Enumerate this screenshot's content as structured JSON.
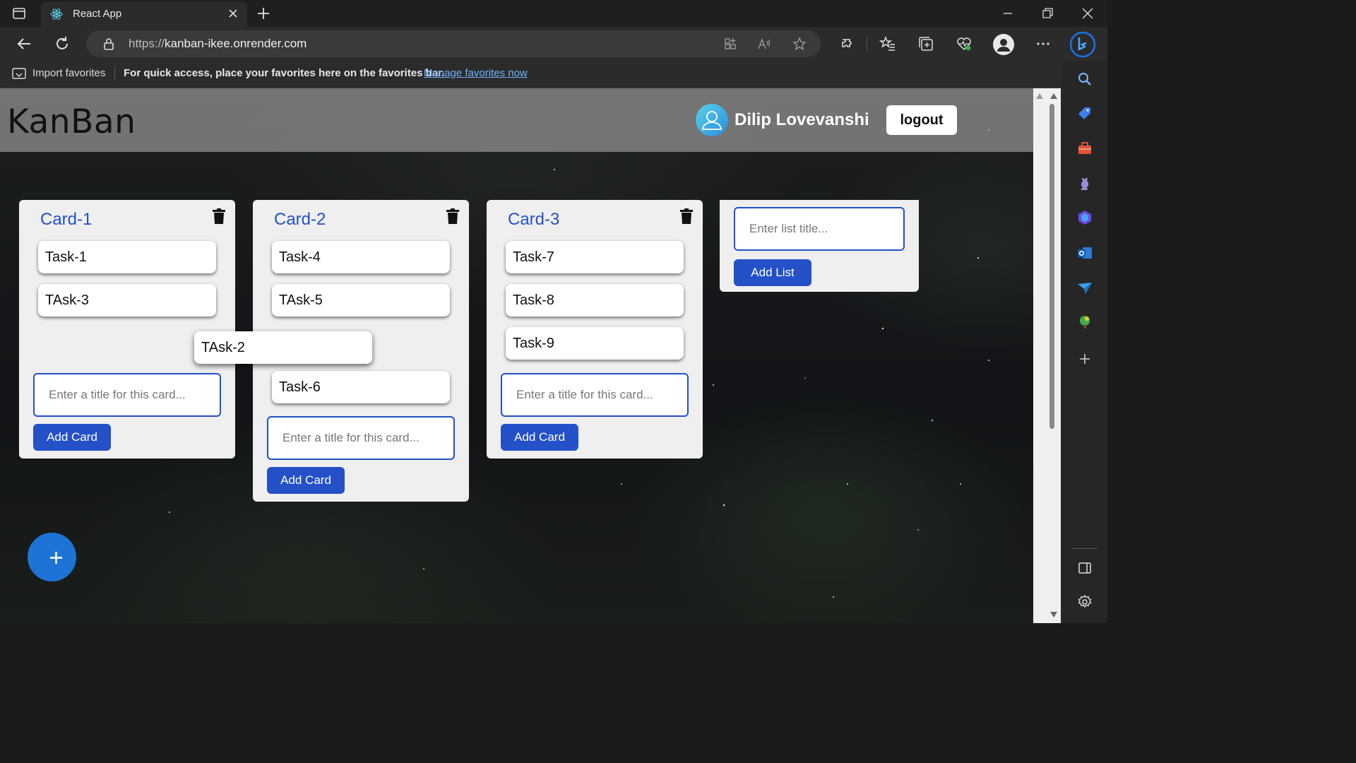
{
  "browser": {
    "tab_title": "React App",
    "url_prefix": "https://",
    "url_host": "kanban-ikee.onrender.com",
    "favorites": {
      "import_label": "Import favorites",
      "message": "For quick access, place your favorites here on the favorites bar.",
      "manage_link": "Manage favorites now"
    }
  },
  "app": {
    "brand": "KanBan",
    "user_name": "Dilip Lovevanshi",
    "logout_label": "logout",
    "card_input_placeholder": "Enter a title for this card...",
    "add_card_label": "Add Card",
    "list_title_placeholder": "Enter list title...",
    "add_list_label": "Add List",
    "dragging_task": "TAsk-2",
    "lists": [
      {
        "title": "Card-1",
        "tasks": [
          "Task-1",
          "TAsk-3"
        ]
      },
      {
        "title": "Card-2",
        "tasks": [
          "Task-4",
          "TAsk-5",
          "Task-6"
        ]
      },
      {
        "title": "Card-3",
        "tasks": [
          "Task-7",
          "Task-8",
          "Task-9"
        ]
      }
    ]
  },
  "colors": {
    "accent": "#2450c8",
    "fab": "#1e73d6",
    "list_bg": "#efefef"
  }
}
